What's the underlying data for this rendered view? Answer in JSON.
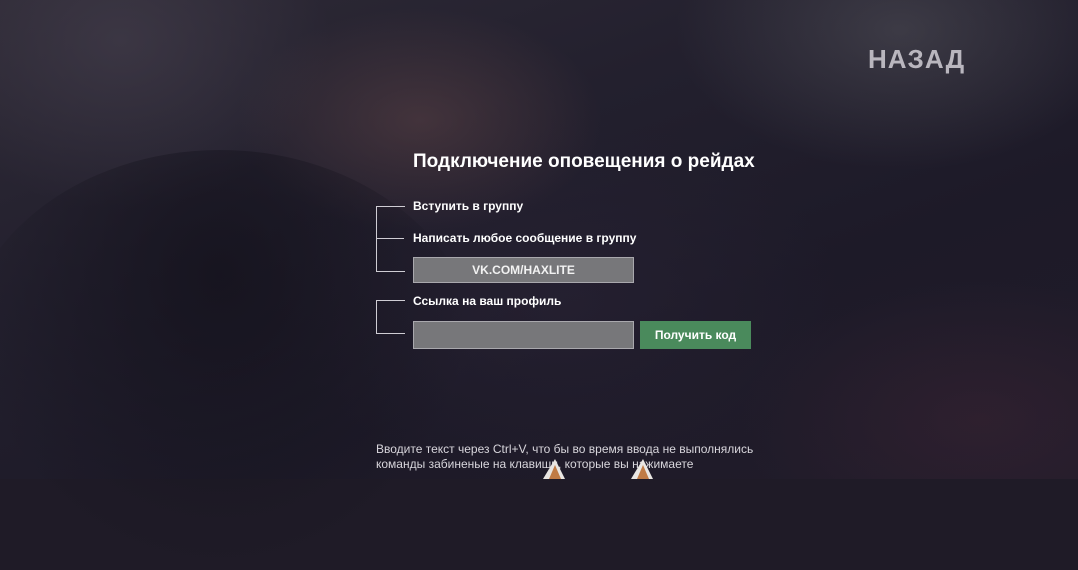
{
  "header": {
    "back_label": "НАЗАД"
  },
  "panel": {
    "title": "Подключение оповещения о рейдах",
    "steps": {
      "join_group": "Вступить в группу",
      "send_message": "Написать любое сообщение в группу",
      "group_link": "VK.COM/HAXLITE",
      "profile_link_label": "Ссылка на ваш профиль",
      "profile_input_value": "",
      "profile_input_placeholder": ""
    },
    "get_code_label": "Получить код"
  },
  "footer": {
    "hint_line1": "Вводите текст через Ctrl+V, что бы во время ввода не выполнялись",
    "hint_line2": "команды забиненые на клавиши, которые вы нажимаете"
  },
  "colors": {
    "accent_button": "#4a8a5c",
    "field_bg": "#77777a",
    "background": "#1f1b27"
  }
}
